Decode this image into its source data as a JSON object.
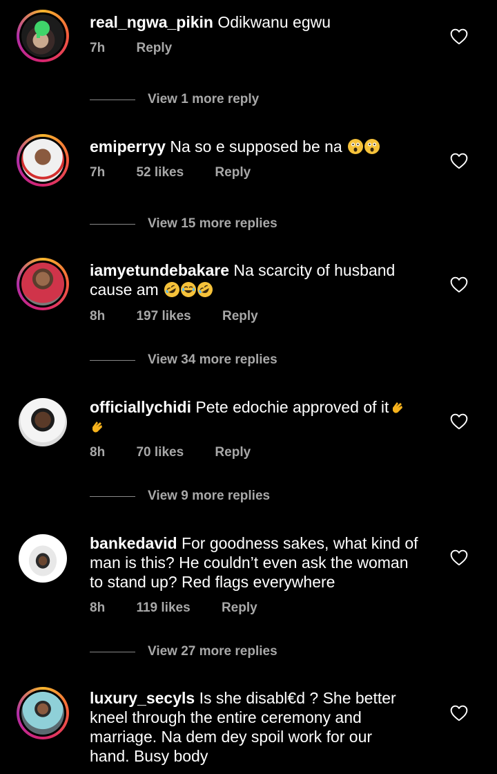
{
  "comments": [
    {
      "username": "real_ngwa_pikin",
      "text": "Odikwanu egwu",
      "time": "7h",
      "likes": "",
      "reply_label": "Reply",
      "view_more": "View 1 more reply"
    },
    {
      "username": "emiperryy",
      "text": "Na so e supposed be na",
      "time": "7h",
      "likes": "52 likes",
      "reply_label": "Reply",
      "view_more": "View 15 more replies"
    },
    {
      "username": "iamyetundebakare",
      "text_line1": "Na scarcity of husband",
      "text_line2": "cause am",
      "time": "8h",
      "likes": "197 likes",
      "reply_label": "Reply",
      "view_more": "View 34 more replies"
    },
    {
      "username": "officiallychidi",
      "text": "Pete edochie approved of it",
      "time": "8h",
      "likes": "70 likes",
      "reply_label": "Reply",
      "view_more": "View 9 more replies"
    },
    {
      "username": "bankedavid",
      "text_line1": "For goodness sakes, what kind of",
      "text_line2": "man is this? He couldn’t even ask the woman",
      "text_line3": "to stand up? Red flags everywhere",
      "time": "8h",
      "likes": "119 likes",
      "reply_label": "Reply",
      "view_more": "View 27 more replies"
    },
    {
      "username": "luxury_secyls",
      "text_line1": "Is she disabl€d ? She better",
      "text_line2": "kneel through the entire ceremony and",
      "text_line3": "marriage.  Na dem dey spoil work for our",
      "text_line4": "hand. Busy body"
    }
  ],
  "icons": {
    "like": "heart-outline-icon",
    "emoji_wow": "astonished-face",
    "emoji_rofl": "rolling-laughing-face",
    "emoji_joy": "tears-of-joy-face",
    "emoji_clap": "clapping-hands"
  },
  "colors": {
    "background": "#000000",
    "text": "#ffffff",
    "secondary": "#a8a8a8"
  }
}
